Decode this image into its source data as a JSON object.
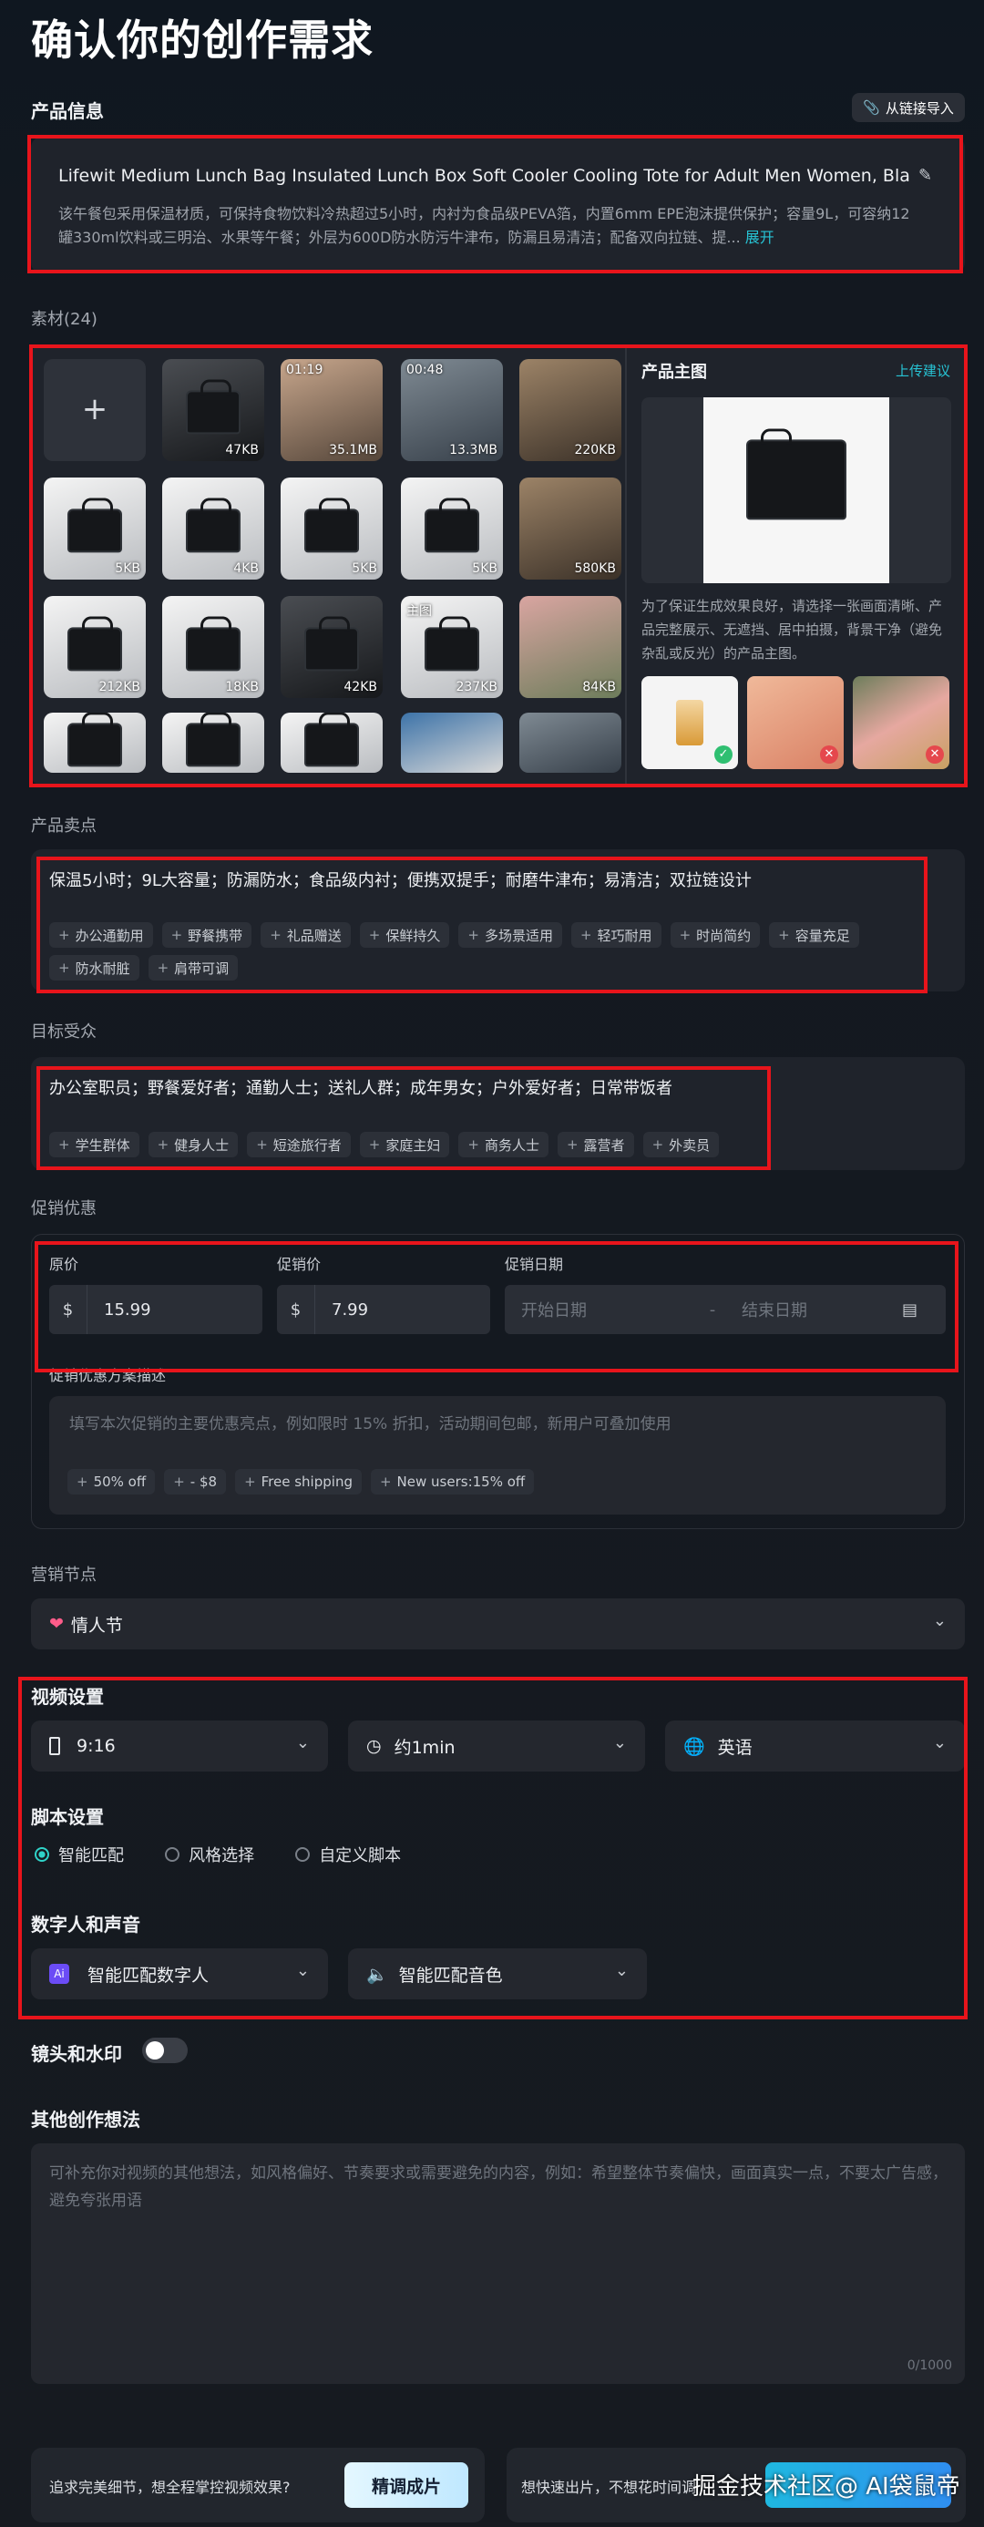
{
  "page": {
    "title": "确认你的创作需求"
  },
  "product_info": {
    "heading": "产品信息",
    "import_label": "从链接导入",
    "title": "Lifewit Medium Lunch Bag Insulated Lunch Box Soft Cooler Cooling Tote for Adult Men Women, Bla",
    "description": "该午餐包采用保温材质，可保持食物饮料冷热超过5小时，内衬为食品级PEVA箔，内置6mm EPE泡沫提供保护；容量9L，可容纳12罐330ml饮料或三明治、水果等午餐；外层为600D防水防污牛津布，防漏且易清洁；配备双向拉链、提...",
    "expand_label": "展开"
  },
  "materials": {
    "heading": "素材(24)",
    "tiles": [
      {
        "type": "add",
        "label": "+"
      },
      {
        "style": "dark",
        "size": "47KB"
      },
      {
        "style": "photo1",
        "size": "35.1MB",
        "duration": "01:19"
      },
      {
        "style": "photo2",
        "size": "13.3MB",
        "duration": "00:48"
      },
      {
        "style": "photo3",
        "size": "220KB"
      },
      {
        "style": "light",
        "size": "5KB"
      },
      {
        "style": "light",
        "size": "4KB"
      },
      {
        "style": "light",
        "size": "5KB"
      },
      {
        "style": "light",
        "size": "5KB"
      },
      {
        "style": "photo3",
        "size": "580KB"
      },
      {
        "style": "light",
        "size": "212KB"
      },
      {
        "style": "light",
        "size": "18KB"
      },
      {
        "style": "dark",
        "size": "42KB"
      },
      {
        "style": "light",
        "size": "237KB",
        "tag": "主图"
      },
      {
        "style": "photo4",
        "size": "84KB"
      },
      {
        "style": "light",
        "size": ""
      },
      {
        "style": "light",
        "size": ""
      },
      {
        "style": "light",
        "size": ""
      },
      {
        "style": "blue",
        "size": ""
      },
      {
        "style": "photo2",
        "size": ""
      }
    ],
    "main_image": {
      "heading": "产品主图",
      "upload_tip": "上传建议",
      "note": "为了保证生成效果良好，请选择一张画面清晰、产品完整展示、无遮挡、居中拍摄，背景干净（避免杂乱或反光）的产品主图。",
      "examples": [
        {
          "status": "good"
        },
        {
          "status": "bad"
        },
        {
          "status": "bad"
        }
      ]
    }
  },
  "selling_points": {
    "heading": "产品卖点",
    "text": "保温5小时；9L大容量；防漏防水；食品级内衬；便携双提手；耐磨牛津布；易清洁；双拉链设计",
    "chips": [
      "办公通勤用",
      "野餐携带",
      "礼品赠送",
      "保鲜持久",
      "多场景适用",
      "轻巧耐用",
      "时尚简约",
      "容量充足",
      "防水耐脏",
      "肩带可调"
    ]
  },
  "audience": {
    "heading": "目标受众",
    "text": "办公室职员；野餐爱好者；通勤人士；送礼人群；成年男女；户外爱好者；日常带饭者",
    "chips": [
      "学生群体",
      "健身人士",
      "短途旅行者",
      "家庭主妇",
      "商务人士",
      "露营者",
      "外卖员"
    ]
  },
  "promotion": {
    "heading": "促销优惠",
    "original_price_label": "原价",
    "promo_price_label": "促销价",
    "date_label": "促销日期",
    "currency": "$",
    "original_price": "15.99",
    "promo_price": "7.99",
    "start_placeholder": "开始日期",
    "date_sep": "-",
    "end_placeholder": "结束日期",
    "desc_label": "促销优惠方案描述",
    "desc_placeholder": "填写本次促销的主要优惠亮点，例如限时 15% 折扣，活动期间包邮，新用户可叠加使用",
    "chips": [
      "50% off",
      "- $8",
      "Free shipping",
      "New users:15% off"
    ]
  },
  "marketing": {
    "heading": "营销节点",
    "value": "情人节"
  },
  "video_settings": {
    "heading": "视频设置",
    "ratio": "9:16",
    "duration": "约1min",
    "language": "英语"
  },
  "script_settings": {
    "heading": "脚本设置",
    "options": [
      "智能匹配",
      "风格选择",
      "自定义脚本"
    ],
    "selected": 0
  },
  "avatar_voice": {
    "heading": "数字人和声音",
    "avatar_badge": "Ai",
    "avatar": "智能匹配数字人",
    "voice": "智能匹配音色"
  },
  "lens_watermark": {
    "label": "镜头和水印"
  },
  "other_ideas": {
    "heading": "其他创作想法",
    "placeholder": "可补充你对视频的其他想法，如风格偏好、节奏要求或需要避免的内容，例如：希望整体节奏偏快，画面真实一点，不要太广告感，避免夸张用语",
    "counter": "0/1000"
  },
  "footer": {
    "left_prompt": "追求完美细节，想全程掌控视频效果?",
    "refine_label": "精调成片",
    "right_prompt": "想快速出片，不想花时间调",
    "watermark": "掘金技术社区@ AI袋鼠帝"
  },
  "colors": {
    "highlight_box": "#e8141b",
    "accent": "#27c3d4",
    "background": "#161a20"
  }
}
